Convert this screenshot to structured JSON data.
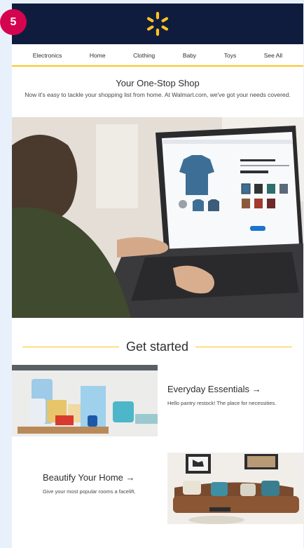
{
  "step_badge": "5",
  "brand": {
    "logo_icon": "spark-icon",
    "logo_color": "#ffc220",
    "header_color": "#0f1c3e"
  },
  "nav": {
    "items": [
      "Electronics",
      "Home",
      "Clothing",
      "Baby",
      "Toys",
      "See All"
    ]
  },
  "intro": {
    "title": "Your One-Stop Shop",
    "subtitle": "Now it's easy to tackle your shopping list from home. At Walmart.com, we've got your needs covered."
  },
  "section": {
    "title": "Get started"
  },
  "cards": [
    {
      "title": "Everyday Essentials →",
      "description": "Hello pantry restock! The place for necessities."
    },
    {
      "title": "Beautify Your Home →",
      "description": "Give your most popular rooms a facelift."
    }
  ]
}
